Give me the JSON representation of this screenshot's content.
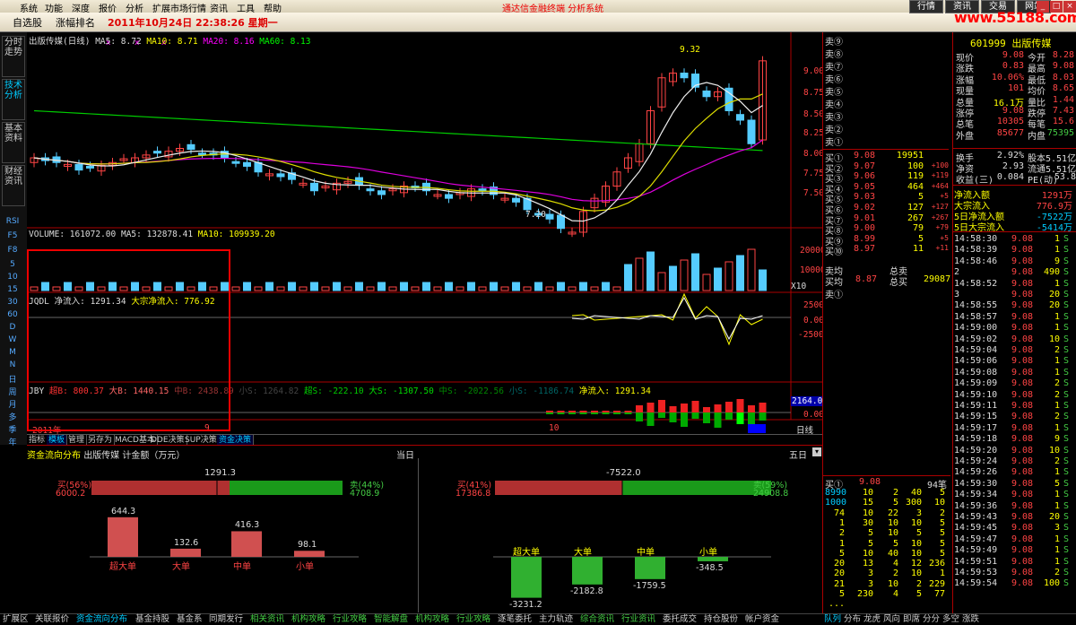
{
  "menu": [
    "系统",
    "功能",
    "深度",
    "报价",
    "分析",
    "扩展市场行情",
    "资讯",
    "工具",
    "帮助"
  ],
  "title_center": "通达信金融终端 分析系统",
  "top_buttons": [
    "行情",
    "资讯",
    "交易",
    "网站"
  ],
  "site": "www.55188.com",
  "toolbar": {
    "tab1": "自选股",
    "tab2": "涨幅排名",
    "datetime": "2011年10月24日 22:38:26 星期一"
  },
  "left_tabs": [
    "分时走势",
    "技术分析",
    "基本资料",
    "财经资讯"
  ],
  "left_icons": [
    "RSI",
    "F5",
    "F8",
    "5",
    "10",
    "15",
    "30",
    "60",
    "D",
    "W",
    "M",
    "N",
    "日",
    "周",
    "月",
    "多",
    "季",
    "年"
  ],
  "chart": {
    "ma_legend": {
      "name": "出版传媒(日线)",
      "ma5": "MA5: 8.72",
      "ma10": "MA10: 8.71",
      "ma20": "MA20: 8.16",
      "ma60": "MA60: 8.13"
    },
    "vol_legend": {
      "vol": "VOLUME: 161072.00",
      "ma5": "MA5: 132878.41",
      "ma10": "MA10: 109939.20"
    },
    "jqdl_legend": {
      "name": "JQDL",
      "net": "净流入: 1291.34",
      "big": "大宗净流入: 776.92"
    },
    "jby_legend": {
      "name": "JBY",
      "a": "超B: 800.37",
      "b": "大B: 1440.15",
      "c": "中B: 2438.89",
      "d": "小S: 1264.82",
      "e": "超S: -222.10",
      "f": "大S: -1307.50",
      "g": "中S: -2022.56",
      "h": "小S: -1186.74",
      "net": "净流入: 1291.34"
    },
    "price_axis": [
      "9.00",
      "8.75",
      "8.50",
      "8.25",
      "8.00",
      "7.75",
      "7.50"
    ],
    "high_label": "9.32",
    "low_label": "7.20",
    "vol_axis": [
      "20000",
      "10000",
      "X10"
    ],
    "jqdl_axis": [
      "2500",
      "0.00",
      "-2500"
    ],
    "jby_axis": [
      "2164.08",
      "0.00"
    ],
    "x_labels": [
      "2011年",
      "9",
      "10"
    ],
    "x_mode": "日线"
  },
  "chart_tabs": [
    "指标",
    "模板",
    "管理",
    "另存为",
    "MACD基本",
    "DDE决策",
    "SUP决策",
    "资金决策"
  ],
  "bottom": {
    "title": "资金流向分布",
    "stock": "出版传媒",
    "unit": "计金额（万元）",
    "day": "当日",
    "period": "五日",
    "left": {
      "net": "1291.3",
      "buy_label": "买(56%)",
      "buy_val": "6000.2",
      "sell_label": "卖(44%)",
      "sell_val": "4708.9",
      "bars": [
        {
          "label": "超大单",
          "value": "644.3",
          "v": 644.3
        },
        {
          "label": "大单",
          "value": "132.6",
          "v": 132.6
        },
        {
          "label": "中单",
          "value": "416.3",
          "v": 416.3
        },
        {
          "label": "小单",
          "value": "98.1",
          "v": 98.1
        }
      ]
    },
    "right": {
      "net": "-7522.0",
      "buy_label": "买(41%)",
      "buy_val": "17386.8",
      "sell_label": "卖(59%)",
      "sell_val": "24908.8",
      "bars": [
        {
          "label": "超大单",
          "value": "-3231.2",
          "v": 3231.2
        },
        {
          "label": "大单",
          "value": "-2182.8",
          "v": 2182.8
        },
        {
          "label": "中单",
          "value": "-1759.5",
          "v": 1759.5
        },
        {
          "label": "小单",
          "value": "-348.5",
          "v": 348.5
        }
      ]
    }
  },
  "bottom_tabs": [
    "扩展区",
    "关联报价",
    "资金流向分布",
    "基金持股",
    "基金系",
    "同期发行",
    "相关资讯",
    "机构攻略",
    "行业攻略",
    "智能解盘",
    "机构攻略",
    "行业攻略",
    "逐笔委托",
    "主力轨迹",
    "综合资讯",
    "行业资讯",
    "委托成交",
    "持仓股份",
    "帐户资金"
  ],
  "right_tabs": [
    "队列",
    "分布",
    "龙虎",
    "风向",
    "即席",
    "分分",
    "多空",
    "涨跌"
  ],
  "quote": {
    "header": "601999 出版传媒",
    "rows": [
      [
        "现价",
        "9.08",
        "今开",
        "8.28"
      ],
      [
        "涨跌",
        "0.83",
        "最高",
        "9.08"
      ],
      [
        "涨幅",
        "10.06%",
        "最低",
        "8.03"
      ],
      [
        "现量",
        "101",
        "均价",
        "8.65"
      ],
      [
        "总量",
        "16.1万",
        "量比",
        "1.44"
      ],
      [
        "涨停",
        "9.08",
        "跌停",
        "7.43"
      ],
      [
        "总笔",
        "10305",
        "每笔",
        "15.6"
      ],
      [
        "外盘",
        "85677",
        "内盘",
        "75395"
      ]
    ],
    "rows2": [
      [
        "换手",
        "2.92%",
        "股本",
        "5.51亿"
      ],
      [
        "净资",
        "2.93",
        "流通",
        "5.51亿"
      ],
      [
        "收益(三)",
        "0.084",
        "PE(动)",
        "53.8"
      ]
    ],
    "flows": [
      [
        "净流入额",
        "1291万"
      ],
      [
        "大宗流入",
        "776.9万"
      ],
      [
        "5日净流入额",
        "-7522万"
      ],
      [
        "5日大宗流入",
        "-5414万"
      ]
    ],
    "sells": [
      "卖⑨",
      "卖⑧",
      "卖⑦",
      "卖⑥",
      "卖⑤",
      "卖④",
      "卖③",
      "卖②",
      "卖①"
    ],
    "buys": [
      [
        "买①",
        "9.08",
        "19951",
        ""
      ],
      [
        "买②",
        "9.07",
        "100",
        "+100"
      ],
      [
        "买③",
        "9.06",
        "119",
        "+119"
      ],
      [
        "买④",
        "9.05",
        "464",
        "+464"
      ],
      [
        "买⑤",
        "9.03",
        "5",
        "+5"
      ],
      [
        "买⑥",
        "9.02",
        "127",
        "+127"
      ],
      [
        "买⑦",
        "9.01",
        "267",
        "+267"
      ],
      [
        "买⑧",
        "9.00",
        "79",
        "+79"
      ],
      [
        "买⑨",
        "8.99",
        "5",
        "+5"
      ],
      [
        "买⑩",
        "8.97",
        "11",
        "+11"
      ]
    ],
    "avg": [
      [
        "卖均",
        "",
        "总卖",
        ""
      ],
      [
        "买均",
        "8.87",
        "总买",
        "29087"
      ]
    ],
    "sell1": "卖①",
    "queue_header": [
      "买①",
      "9.08",
      "94笔"
    ],
    "queue": [
      [
        "8990",
        "10",
        "2",
        "40",
        "5"
      ],
      [
        "1000",
        "15",
        "5",
        "300",
        "10"
      ],
      [
        "74",
        "10",
        "22",
        "3",
        "2"
      ],
      [
        "1",
        "30",
        "10",
        "10",
        "5"
      ],
      [
        "2",
        "5",
        "10",
        "5",
        "5"
      ],
      [
        "1",
        "5",
        "5",
        "10",
        "5"
      ],
      [
        "5",
        "10",
        "40",
        "10",
        "5"
      ],
      [
        "20",
        "13",
        "4",
        "12",
        "236"
      ],
      [
        "20",
        "3",
        "2",
        "10",
        "1"
      ],
      [
        "21",
        "3",
        "10",
        "2",
        "229"
      ],
      [
        "5",
        "230",
        "4",
        "5",
        "77"
      ],
      [
        "...",
        "",
        "",
        "",
        ""
      ]
    ]
  },
  "ticks": [
    [
      "14:58:30",
      "9.08",
      "1",
      "S"
    ],
    [
      "14:58:39",
      "9.08",
      "1",
      "S"
    ],
    [
      "14:58:46",
      "9.08",
      "9",
      "S"
    ],
    [
      "2",
      "9.08",
      "490",
      "S"
    ],
    [
      "14:58:52",
      "9.08",
      "1",
      "S"
    ],
    [
      "3",
      "9.08",
      "20",
      "S"
    ],
    [
      "14:58:55",
      "9.08",
      "20",
      "S"
    ],
    [
      "14:58:57",
      "9.08",
      "1",
      "S"
    ],
    [
      "14:59:00",
      "9.08",
      "1",
      "S"
    ],
    [
      "14:59:02",
      "9.08",
      "10",
      "S"
    ],
    [
      "14:59:04",
      "9.08",
      "2",
      "S"
    ],
    [
      "14:59:06",
      "9.08",
      "1",
      "S"
    ],
    [
      "14:59:08",
      "9.08",
      "1",
      "S"
    ],
    [
      "14:59:09",
      "9.08",
      "2",
      "S"
    ],
    [
      "14:59:10",
      "9.08",
      "2",
      "S"
    ],
    [
      "14:59:11",
      "9.08",
      "1",
      "S"
    ],
    [
      "14:59:15",
      "9.08",
      "2",
      "S"
    ],
    [
      "14:59:17",
      "9.08",
      "1",
      "S"
    ],
    [
      "14:59:18",
      "9.08",
      "9",
      "S"
    ],
    [
      "14:59:20",
      "9.08",
      "10",
      "S"
    ],
    [
      "14:59:24",
      "9.08",
      "2",
      "S"
    ],
    [
      "14:59:26",
      "9.08",
      "1",
      "S"
    ],
    [
      "14:59:30",
      "9.08",
      "5",
      "S"
    ],
    [
      "14:59:34",
      "9.08",
      "1",
      "S"
    ],
    [
      "14:59:36",
      "9.08",
      "1",
      "S"
    ],
    [
      "14:59:43",
      "9.08",
      "20",
      "S"
    ],
    [
      "14:59:45",
      "9.08",
      "3",
      "S"
    ],
    [
      "14:59:47",
      "9.08",
      "1",
      "S"
    ],
    [
      "14:59:49",
      "9.08",
      "1",
      "S"
    ],
    [
      "14:59:51",
      "9.08",
      "1",
      "S"
    ],
    [
      "14:59:53",
      "9.08",
      "2",
      "S"
    ],
    [
      "14:59:54",
      "9.08",
      "100",
      "S"
    ]
  ]
}
